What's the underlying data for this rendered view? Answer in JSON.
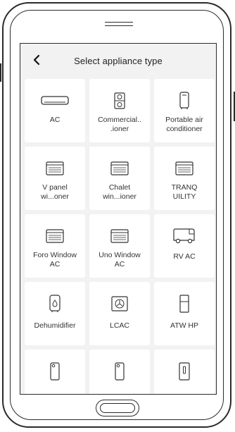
{
  "header": {
    "title": "Select appliance type",
    "back_icon": "chevron-left-icon"
  },
  "tiles": [
    {
      "label": "AC",
      "icon": "split-ac-icon"
    },
    {
      "label": "Commercial..\n.ioner",
      "icon": "commercial-ac-icon"
    },
    {
      "label": "Portable air\nconditioner",
      "icon": "portable-ac-icon"
    },
    {
      "label": "V panel\nwi...oner",
      "icon": "window-ac-icon"
    },
    {
      "label": "Chalet\nwin...ioner",
      "icon": "window-ac-icon"
    },
    {
      "label": "TRANQ\nUILITY",
      "icon": "window-ac-icon"
    },
    {
      "label": "Foro Window\nAC",
      "icon": "window-ac-icon"
    },
    {
      "label": "Uno Window\nAC",
      "icon": "window-ac-icon"
    },
    {
      "label": "RV AC",
      "icon": "rv-icon"
    },
    {
      "label": "Dehumidifier",
      "icon": "dehumidifier-icon"
    },
    {
      "label": "LCAC",
      "icon": "fan-unit-icon"
    },
    {
      "label": "ATW HP",
      "icon": "heat-pump-icon"
    },
    {
      "label": "",
      "icon": "tower-unit-icon"
    },
    {
      "label": "",
      "icon": "tower-unit-icon"
    },
    {
      "label": "",
      "icon": "indoor-unit-icon"
    }
  ]
}
